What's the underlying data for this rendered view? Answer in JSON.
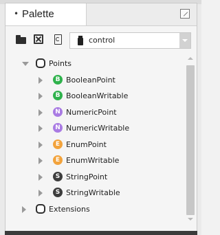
{
  "panel": {
    "tab_bullet": "•",
    "title": "Palette"
  },
  "toolbar": {
    "module_select_value": "control"
  },
  "tree": [
    {
      "label": "Points",
      "type": "folder",
      "state": "expanded",
      "level": 0
    },
    {
      "label": "BooleanPoint",
      "type": "point",
      "badge": "B",
      "badge_color": "#2fb24c",
      "state": "collapsed",
      "level": 1
    },
    {
      "label": "BooleanWritable",
      "type": "point",
      "badge": "B",
      "badge_color": "#2fb24c",
      "state": "collapsed",
      "level": 1
    },
    {
      "label": "NumericPoint",
      "type": "point",
      "badge": "N",
      "badge_color": "#a97be3",
      "state": "collapsed",
      "level": 1
    },
    {
      "label": "NumericWritable",
      "type": "point",
      "badge": "N",
      "badge_color": "#a97be3",
      "state": "collapsed",
      "level": 1
    },
    {
      "label": "EnumPoint",
      "type": "point",
      "badge": "E",
      "badge_color": "#f2a33c",
      "state": "collapsed",
      "level": 1
    },
    {
      "label": "EnumWritable",
      "type": "point",
      "badge": "E",
      "badge_color": "#f2a33c",
      "state": "collapsed",
      "level": 1
    },
    {
      "label": "StringPoint",
      "type": "point",
      "badge": "S",
      "badge_color": "#3d3d3d",
      "state": "collapsed",
      "level": 1
    },
    {
      "label": "StringWritable",
      "type": "point",
      "badge": "S",
      "badge_color": "#3d3d3d",
      "state": "collapsed",
      "level": 1
    },
    {
      "label": "Extensions",
      "type": "folder",
      "state": "collapsed",
      "level": 0
    }
  ]
}
